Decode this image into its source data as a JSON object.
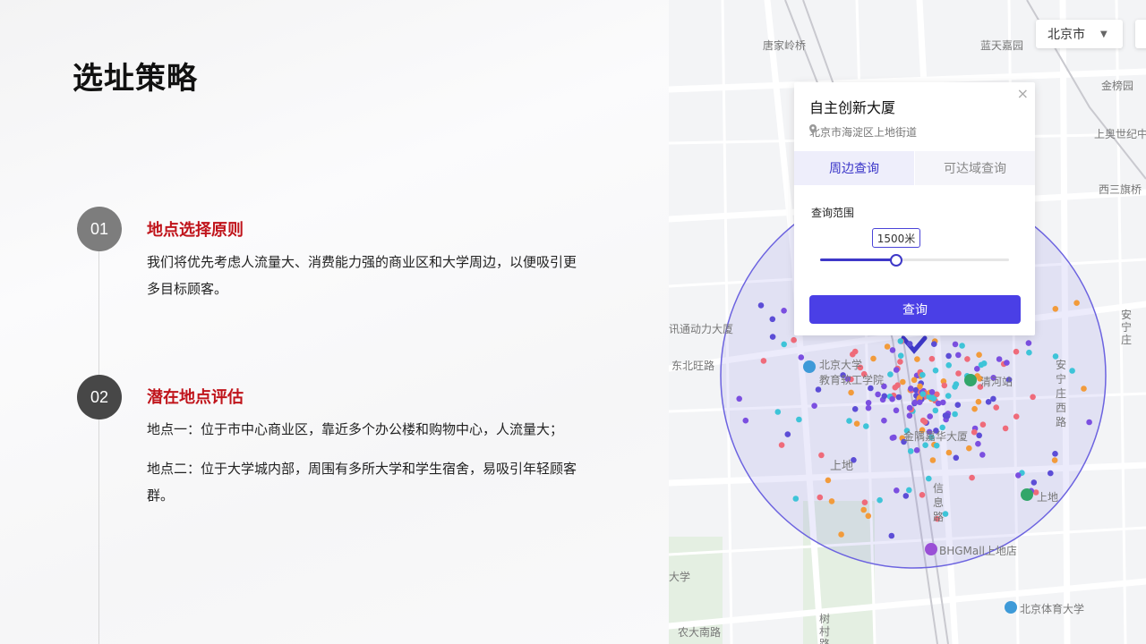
{
  "slide": {
    "title": "选址策略",
    "sections": [
      {
        "num": "01",
        "heading": "地点选择原则",
        "paragraphs": [
          "我们将优先考虑人流量大、消费能力强的商业区和大学周边，以便吸引更多目标顾客。"
        ]
      },
      {
        "num": "02",
        "heading": "潜在地点评估",
        "paragraphs": [
          "地点一：位于市中心商业区，靠近多个办公楼和购物中心，人流量大；",
          "地点二：位于大学城内部，周围有多所大学和学生宿舍，易吸引年轻顾客群。"
        ]
      }
    ]
  },
  "map": {
    "city_select": "北京市",
    "popup": {
      "title": "自主创新大厦",
      "address": "北京市海淀区上地街道",
      "tabs": [
        "周边查询",
        "可达域查询"
      ],
      "range_label": "查询范围",
      "range_value": "1500米",
      "slider_fraction": 0.4,
      "button": "查询"
    },
    "labels": {
      "l1": "唐家岭桥",
      "l2": "蓝天嘉园",
      "l3": "金榜园",
      "l4": "上奥世纪中",
      "l5": "西三旗桥",
      "l6": "讯通动力大厦",
      "l7": "东北旺路",
      "l8": "北京大学",
      "l9": "教育软工学院",
      "l10": "清河站",
      "l11": "安宁庄西路",
      "l12": "金隅嘉华大厦",
      "l13": "上地",
      "l14": "信息路",
      "l15": "上地",
      "l16": "BHGMall上地店",
      "l17": "大学",
      "l18": "北京体育大学",
      "l19": "农大南路",
      "l20": "树村路",
      "l21": "安宁庄"
    },
    "colors": {
      "circle": "#6c63e0",
      "accent": "#4a3fe6",
      "poi": [
        "#7b4fe0",
        "#ef6b7a",
        "#3ec4d8",
        "#f29b3b",
        "#5c4dd6"
      ]
    }
  }
}
